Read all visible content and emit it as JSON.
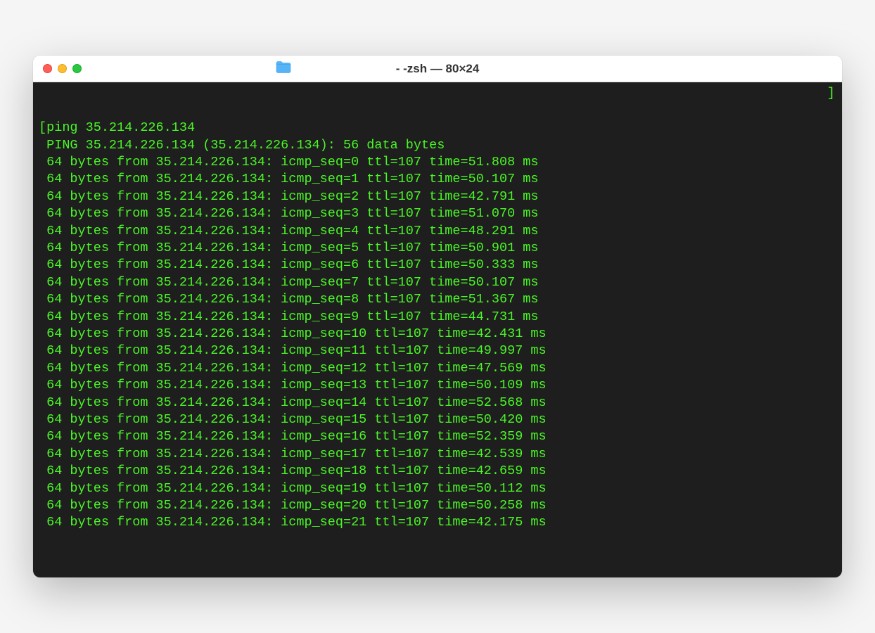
{
  "window": {
    "title": "- -zsh — 80×24"
  },
  "terminal": {
    "command": "ping 35.214.226.134",
    "header": "PING 35.214.226.134 (35.214.226.134): 56 data bytes",
    "ip": "35.214.226.134",
    "bytes": 64,
    "ttl": 107,
    "replies": [
      {
        "seq": 0,
        "time": "51.808"
      },
      {
        "seq": 1,
        "time": "50.107"
      },
      {
        "seq": 2,
        "time": "42.791"
      },
      {
        "seq": 3,
        "time": "51.070"
      },
      {
        "seq": 4,
        "time": "48.291"
      },
      {
        "seq": 5,
        "time": "50.901"
      },
      {
        "seq": 6,
        "time": "50.333"
      },
      {
        "seq": 7,
        "time": "50.107"
      },
      {
        "seq": 8,
        "time": "51.367"
      },
      {
        "seq": 9,
        "time": "44.731"
      },
      {
        "seq": 10,
        "time": "42.431"
      },
      {
        "seq": 11,
        "time": "49.997"
      },
      {
        "seq": 12,
        "time": "47.569"
      },
      {
        "seq": 13,
        "time": "50.109"
      },
      {
        "seq": 14,
        "time": "52.568"
      },
      {
        "seq": 15,
        "time": "50.420"
      },
      {
        "seq": 16,
        "time": "52.359"
      },
      {
        "seq": 17,
        "time": "42.539"
      },
      {
        "seq": 18,
        "time": "42.659"
      },
      {
        "seq": 19,
        "time": "50.112"
      },
      {
        "seq": 20,
        "time": "50.258"
      },
      {
        "seq": 21,
        "time": "42.175"
      }
    ]
  }
}
